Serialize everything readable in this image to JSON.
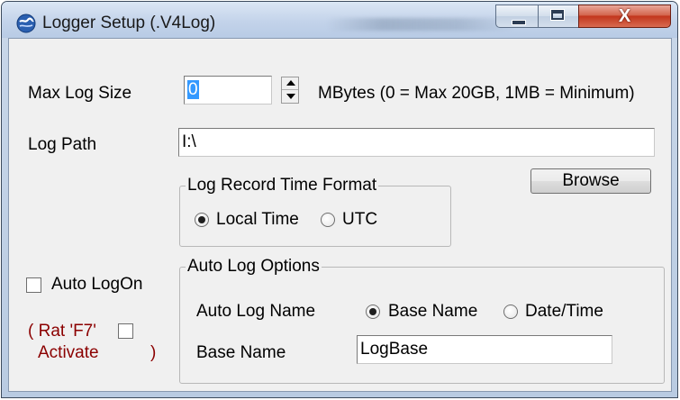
{
  "window": {
    "title": "Logger Setup (.V4Log)",
    "close_glyph": "X"
  },
  "colors": {
    "titlebar": "#c3d3ea",
    "client_bg": "#f0f0f0",
    "close_button": "#c2361d",
    "hotkey_text": "#8b0000",
    "selection": "#3399ff"
  },
  "icons": {
    "app": "logger-globe-icon",
    "minimize": "minimize-icon",
    "maximize": "maximize-icon",
    "close": "close-icon",
    "spin_up": "spin-up-arrow-icon",
    "spin_down": "spin-down-arrow-icon"
  },
  "max_log_size": {
    "label": "Max Log Size",
    "value": "0",
    "hint": "MBytes (0 = Max 20GB, 1MB = Minimum)"
  },
  "log_path": {
    "label": "Log Path",
    "value": "I:\\"
  },
  "browse_button": {
    "label": "Browse"
  },
  "time_format": {
    "title": "Log Record Time Format",
    "options": [
      {
        "label": "Local Time",
        "selected": true
      },
      {
        "label": "UTC",
        "selected": false
      }
    ]
  },
  "auto_logon": {
    "label": "Auto LogOn",
    "checked": false
  },
  "hotkey": {
    "prefix": "( Rat 'F7'",
    "activate": "Activate",
    "suffix": ")",
    "checked": false
  },
  "auto_log_options": {
    "title": "Auto Log Options",
    "name_label": "Auto Log Name",
    "name_options": [
      {
        "label": "Base Name",
        "selected": true
      },
      {
        "label": "Date/Time",
        "selected": false
      }
    ],
    "base_name_label": "Base Name",
    "base_name_value": "LogBase"
  }
}
